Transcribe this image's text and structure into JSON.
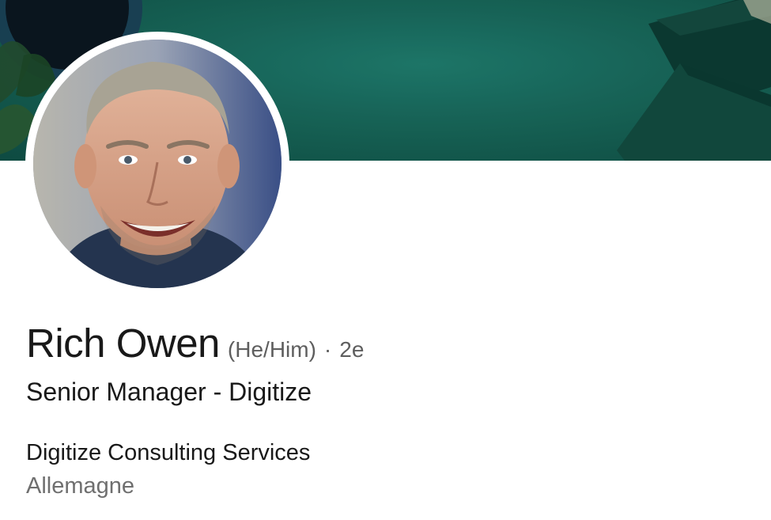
{
  "profile": {
    "name": "Rich Owen",
    "pronouns": "(He/Him)",
    "separator": "·",
    "connection_degree": "2e",
    "headline": "Senior Manager - Digitize",
    "company": "Digitize Consulting Services",
    "location": "Allemagne"
  },
  "colors": {
    "banner": "#176558",
    "name_text": "#191919",
    "secondary_text": "#5e5e5e",
    "location_text": "#6f6f6f"
  },
  "icons": {
    "avatar": "profile-photo",
    "banner": "cover-image"
  }
}
